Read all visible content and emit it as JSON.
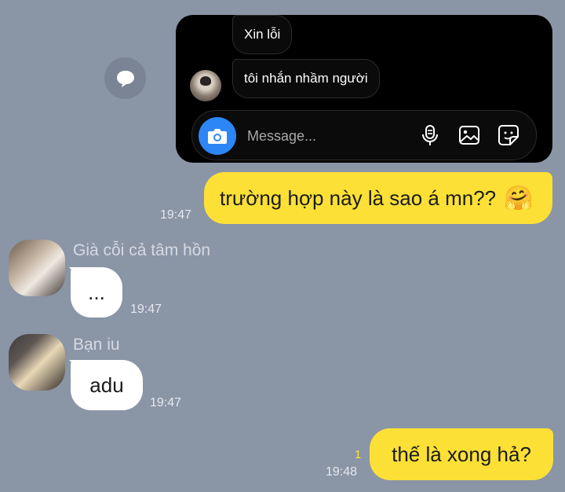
{
  "shared_screenshot": {
    "messages": [
      {
        "text": "Xin lỗi"
      },
      {
        "text": "tôi nhắn nhầm người"
      }
    ],
    "input_placeholder": "Message...",
    "icons": [
      "camera-icon",
      "microphone-icon",
      "image-icon",
      "sticker-icon"
    ]
  },
  "chat": {
    "messages": [
      {
        "side": "me",
        "text": "trường hợp này là sao á mn??",
        "emoji": "🤗",
        "time": "19:47"
      },
      {
        "side": "them",
        "sender": "Già cỗi cả tâm hồn",
        "text": "...",
        "time": "19:47"
      },
      {
        "side": "them",
        "sender": "Bạn iu",
        "text": "adu",
        "time": "19:47"
      },
      {
        "side": "me",
        "text": "thế là xong hả?",
        "time": "19:48",
        "unread": "1"
      }
    ]
  },
  "colors": {
    "background": "#8a95a6",
    "my_bubble": "#fde036",
    "their_bubble": "#ffffff",
    "instagram_blue": "#2d86f5"
  }
}
